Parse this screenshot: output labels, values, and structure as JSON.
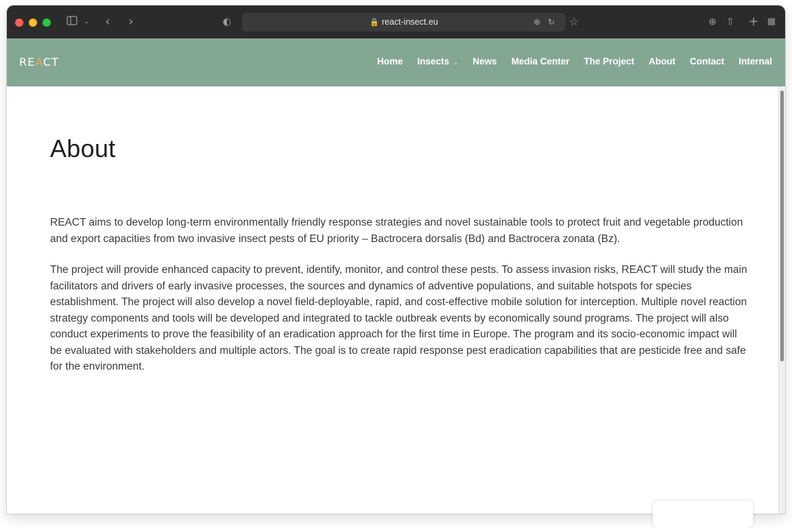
{
  "browser": {
    "url": "react-insect.eu",
    "colors": {
      "close": "#fe5f57",
      "minimize": "#febc2e",
      "maximize": "#28c840"
    },
    "icons": [
      "sidebar-icon",
      "chevron-down-icon",
      "back-icon",
      "forward-icon",
      "shield-icon",
      "lock-icon",
      "translate-icon",
      "reload-icon",
      "star-icon",
      "download-icon",
      "share-icon",
      "new-tab-icon",
      "tab-overview-icon"
    ]
  },
  "site": {
    "logo": {
      "prefix": "RE",
      "mark": "A",
      "suffix": "CT"
    },
    "header_color": "#84a794",
    "nav": [
      {
        "label": "Home"
      },
      {
        "label": "Insects",
        "has_dropdown": true
      },
      {
        "label": "News"
      },
      {
        "label": "Media Center"
      },
      {
        "label": "The Project"
      },
      {
        "label": "About"
      },
      {
        "label": "Contact"
      },
      {
        "label": "Internal"
      }
    ]
  },
  "page": {
    "title": "About",
    "paragraphs": [
      "REACT aims to develop long-term environmentally friendly response strategies and novel sustainable tools to protect fruit and vegetable production and export capacities from two invasive insect pests of EU priority – Bactrocera dorsalis (Bd) and Bactrocera zonata (Bz).",
      "The project will provide enhanced capacity to prevent, identify, monitor, and control these pests. To assess invasion risks, REACT will study the main facilitators and drivers of early invasive processes, the sources and dynamics of adventive populations, and suitable hotspots for species establishment. The project will also develop a novel field-deployable, rapid, and cost-effective mobile solution for interception. Multiple novel reaction strategy components and tools will be developed and integrated to tackle outbreak events by economically sound programs. The project will also conduct experiments to prove the feasibility of an eradication approach for the first time in Europe. The program and its socio-economic impact will be evaluated with stakeholders and multiple actors. The goal is to create rapid response pest eradication capabilities that are pesticide free and safe for the environment."
    ]
  }
}
